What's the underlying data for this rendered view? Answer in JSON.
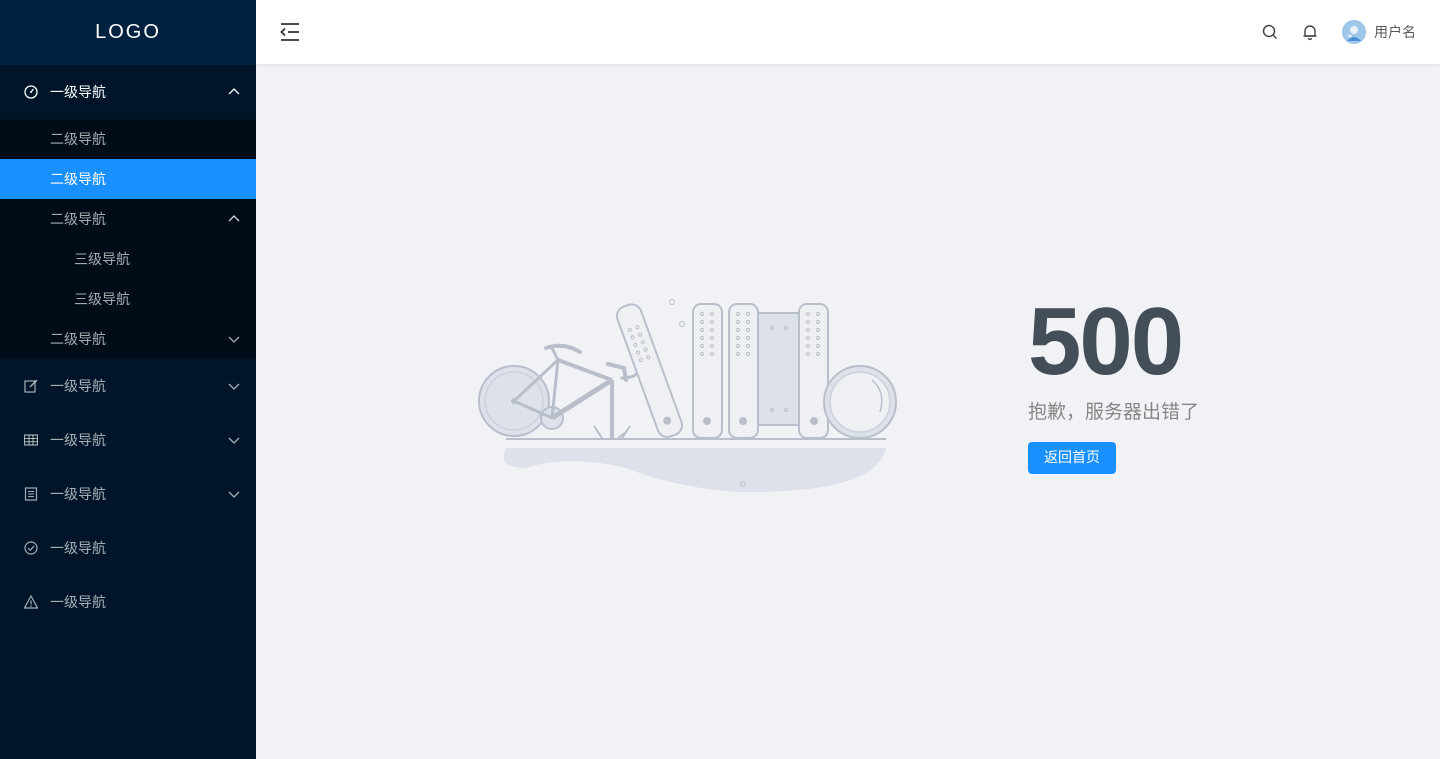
{
  "sidebar": {
    "logo": "LOGO",
    "nav1_open": {
      "label": "一级导航",
      "icon": "dashboard-icon",
      "expanded": true,
      "children": [
        {
          "label": "二级导航"
        },
        {
          "label": "二级导航",
          "selected": true
        },
        {
          "label": "二级导航",
          "expanded": true,
          "children": [
            {
              "label": "三级导航"
            },
            {
              "label": "三级导航"
            }
          ]
        },
        {
          "label": "二级导航",
          "expanded": false
        }
      ]
    },
    "items": [
      {
        "label": "一级导航",
        "icon": "edit-icon"
      },
      {
        "label": "一级导航",
        "icon": "table-icon"
      },
      {
        "label": "一级导航",
        "icon": "profile-icon"
      },
      {
        "label": "一级导航",
        "icon": "check-circle-icon"
      },
      {
        "label": "一级导航",
        "icon": "warning-icon"
      }
    ]
  },
  "header": {
    "username": "用户名"
  },
  "error": {
    "code": "500",
    "description": "抱歉，服务器出错了",
    "button": "返回首页"
  },
  "colors": {
    "sidebar": "#001529",
    "submenu": "#000c17",
    "accent": "#1890ff",
    "code": "#434e59"
  }
}
